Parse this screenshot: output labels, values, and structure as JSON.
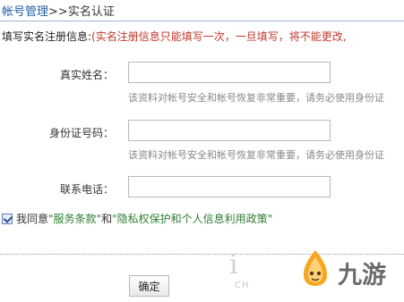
{
  "breadcrumb": {
    "parent": "帐号管理",
    "separator": ">>",
    "current": "实名认证"
  },
  "intro": {
    "lead": "填写实名注册信息:",
    "warning": "(实名注册信息只能填写一次，一旦填写，将不能更改,"
  },
  "form": {
    "real_name": {
      "label": "真实姓名：",
      "value": "",
      "hint": "该资料对帐号安全和帐号恢复非常重要，请务必使用身份证"
    },
    "id_number": {
      "label": "身份证号码：",
      "value": "",
      "hint": "该资料对帐号安全和帐号恢复非常重要，请务必使用身份证"
    },
    "phone": {
      "label": "联系电话：",
      "value": ""
    }
  },
  "agreement": {
    "checked": true,
    "prefix": "我同意",
    "terms_link": "\"服务条款\"",
    "conjunction": "和",
    "privacy_link": "\"隐私权保护和个人信息利用政策\""
  },
  "submit_label": "确定",
  "watermark": {
    "letter": "i",
    "sub": "CH",
    "brand": "九游",
    "logo_color": "#f5a623",
    "icon": "jiuyou-mascot-logo-icon"
  },
  "colors": {
    "link": "#1f5fa8",
    "warning": "#c0392b",
    "agree_link": "#2e7d32"
  }
}
